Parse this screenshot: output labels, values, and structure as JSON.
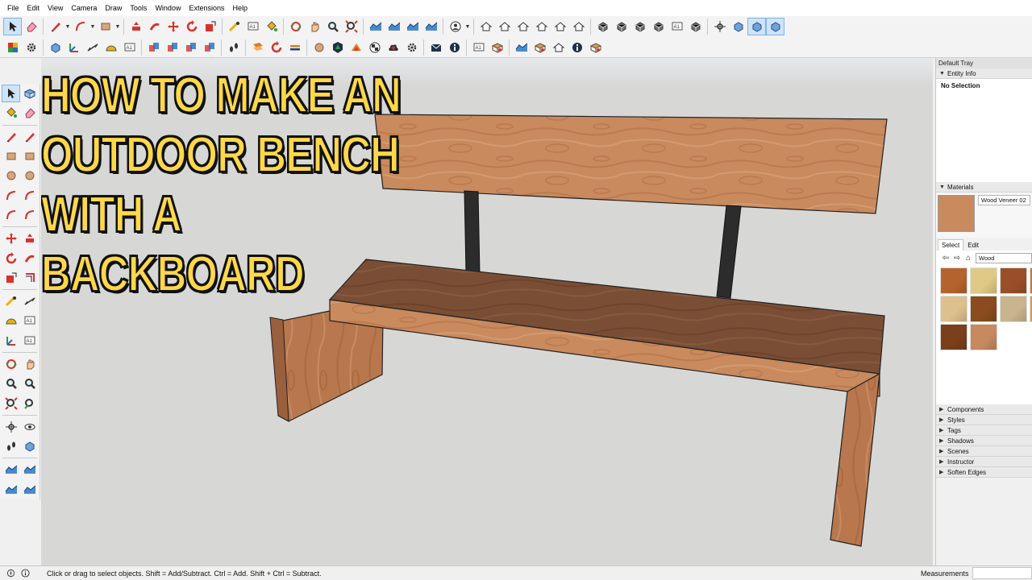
{
  "menu": [
    "File",
    "Edit",
    "View",
    "Camera",
    "Draw",
    "Tools",
    "Window",
    "Extensions",
    "Help"
  ],
  "toolbar1": [
    {
      "name": "select-icon",
      "active": true
    },
    {
      "name": "eraser-icon"
    },
    {
      "sep": true
    },
    {
      "name": "pencil-line-icon"
    },
    {
      "dd": true
    },
    {
      "name": "arc-icon"
    },
    {
      "dd": true
    },
    {
      "name": "rectangle-icon"
    },
    {
      "dd": true
    },
    {
      "sep": true
    },
    {
      "name": "push-pull-icon"
    },
    {
      "name": "follow-me-icon"
    },
    {
      "name": "move-icon"
    },
    {
      "name": "rotate-icon"
    },
    {
      "name": "scale-icon"
    },
    {
      "sep": true
    },
    {
      "name": "tape-measure-icon"
    },
    {
      "name": "text-icon"
    },
    {
      "name": "paint-bucket-icon"
    },
    {
      "sep": true
    },
    {
      "name": "orbit-icon"
    },
    {
      "name": "pan-icon"
    },
    {
      "name": "zoom-icon"
    },
    {
      "name": "zoom-extents-icon"
    },
    {
      "sep": true
    },
    {
      "name": "sandbox-icon"
    },
    {
      "name": "sandbox-from-scratch-icon"
    },
    {
      "name": "smoove-icon"
    },
    {
      "name": "stamp-icon"
    },
    {
      "sep": true
    },
    {
      "name": "user-account-icon"
    },
    {
      "dd": true
    },
    {
      "sep": true
    },
    {
      "name": "iso-view-icon"
    },
    {
      "name": "top-view-icon"
    },
    {
      "name": "front-view-icon"
    },
    {
      "name": "right-view-icon"
    },
    {
      "name": "back-view-icon"
    },
    {
      "name": "left-view-icon"
    },
    {
      "sep": true
    },
    {
      "name": "xray-style-icon"
    },
    {
      "name": "wireframe-style-icon"
    },
    {
      "name": "hidden-line-style-icon"
    },
    {
      "name": "shaded-style-icon"
    },
    {
      "name": "textured-style-icon"
    },
    {
      "name": "monochrome-style-icon"
    },
    {
      "sep": true
    },
    {
      "name": "position-camera-icon"
    },
    {
      "name": "section-plane-icon"
    },
    {
      "name": "display-section-icon",
      "active": true
    },
    {
      "name": "display-section-cuts-icon",
      "active": true
    }
  ],
  "toolbar2": [
    {
      "name": "color-by-layer-icon"
    },
    {
      "name": "settings-gear-icon"
    },
    {
      "sep": true
    },
    {
      "name": "section-plane-2-icon"
    },
    {
      "name": "axes-icon"
    },
    {
      "name": "dimension-icon"
    },
    {
      "name": "protractor-icon"
    },
    {
      "name": "3d-text-icon"
    },
    {
      "sep": true
    },
    {
      "name": "solid-union-icon"
    },
    {
      "name": "solid-subtract-icon"
    },
    {
      "name": "solid-trim-icon"
    },
    {
      "name": "solid-split-icon"
    },
    {
      "sep": true
    },
    {
      "name": "walk-icon"
    },
    {
      "sep": true
    },
    {
      "name": "layout-icon"
    },
    {
      "name": "refresh-icon"
    },
    {
      "name": "add-location-icon"
    },
    {
      "sep": true
    },
    {
      "name": "add-circle-icon"
    },
    {
      "name": "extension-warehouse-icon"
    },
    {
      "name": "3d-warehouse-icon"
    },
    {
      "name": "checker-icon"
    },
    {
      "name": "cloud-upload-icon"
    },
    {
      "name": "components-gear-icon"
    },
    {
      "sep": true
    },
    {
      "name": "message-icon"
    },
    {
      "name": "info-icon"
    },
    {
      "sep": true
    },
    {
      "name": "add-photo-texture-icon"
    },
    {
      "name": "photo-match-icon"
    },
    {
      "sep": true
    },
    {
      "name": "terrain-icon"
    },
    {
      "name": "geo-icon"
    },
    {
      "name": "preview-icon"
    },
    {
      "name": "model-info-icon"
    },
    {
      "name": "lock-icon"
    }
  ],
  "lefttools": [
    [
      "select-icon",
      "component-icon"
    ],
    [
      "paint-bucket-icon",
      "eraser-icon"
    ],
    [
      "sep"
    ],
    [
      "pencil-line-icon",
      "freehand-icon"
    ],
    [
      "rectangle-icon",
      "rotated-rectangle-icon"
    ],
    [
      "circle-icon",
      "polygon-icon"
    ],
    [
      "arc-icon",
      "two-point-arc-icon"
    ],
    [
      "three-point-arc-icon",
      "pie-icon"
    ],
    [
      "sep"
    ],
    [
      "move-icon",
      "push-pull-icon"
    ],
    [
      "rotate-icon",
      "follow-me-icon"
    ],
    [
      "scale-icon",
      "offset-icon"
    ],
    [
      "sep"
    ],
    [
      "tape-measure-icon",
      "dimension-icon"
    ],
    [
      "protractor-icon",
      "text-icon"
    ],
    [
      "axes-icon",
      "3d-text-icon"
    ],
    [
      "sep"
    ],
    [
      "orbit-icon",
      "pan-icon"
    ],
    [
      "zoom-icon",
      "zoom-window-icon"
    ],
    [
      "zoom-extents-icon",
      "previous-view-icon"
    ],
    [
      "sep"
    ],
    [
      "position-camera-icon",
      "look-around-icon"
    ],
    [
      "walk-icon",
      "section-plane-icon"
    ],
    [
      "sep"
    ],
    [
      "sandbox-icon",
      "smoove-icon"
    ],
    [
      "stamp-icon",
      "drape-icon"
    ]
  ],
  "title_lines": [
    "HOW TO MAKE AN",
    "OUTDOOR BENCH",
    "WITH A",
    "BACKBOARD"
  ],
  "tray": {
    "title": "Default Tray",
    "entity_info": {
      "label": "Entity Info",
      "content": "No Selection"
    },
    "materials": {
      "label": "Materials",
      "current_name": "Wood Veneer 02",
      "tabs": [
        "Select",
        "Edit"
      ],
      "active_tab": "Select",
      "collection": "Wood",
      "swatch_colors": [
        "#b5632e",
        "#e0c986",
        "#9a4f28",
        "#c07a45",
        "#dcc08e",
        "#8a4c1e",
        "#c8b58e",
        "#d29a58",
        "#7b3f1c",
        "#c78a5f"
      ]
    },
    "collapsed_sections": [
      "Components",
      "Styles",
      "Tags",
      "Shadows",
      "Scenes",
      "Instructor",
      "Soften Edges"
    ]
  },
  "status": {
    "text": "Click or drag to select objects. Shift = Add/Subtract. Ctrl = Add. Shift + Ctrl = Subtract.",
    "measurements_label": "Measurements",
    "measurements_value": ""
  },
  "colors": {
    "title_fill": "#ffd84a",
    "wood_light": "#c98a5e",
    "wood_dark": "#7a4e35",
    "wood_front": "#a86a46",
    "post": "#2c2c2c",
    "viewport_bg": "#d7d7d5"
  }
}
